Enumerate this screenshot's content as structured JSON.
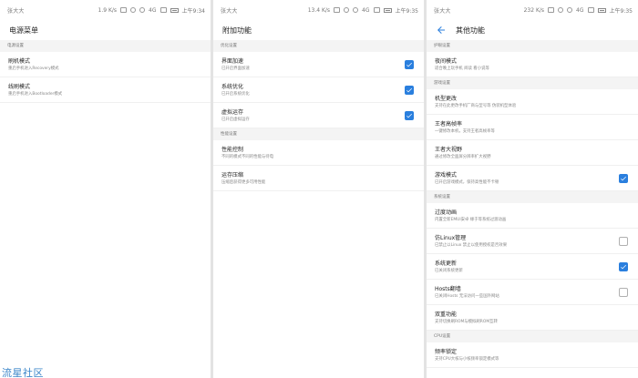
{
  "accent_color": "#2a7fde",
  "status_bars": [
    {
      "carrier": "张大大",
      "speed": "1.9 K/s",
      "network": "4G",
      "time": "上午9:34"
    },
    {
      "carrier": "张大大",
      "speed": "13.4 K/s",
      "network": "4G",
      "time": "上午9:35"
    },
    {
      "carrier": "张大大",
      "speed": "232 K/s",
      "network": "4G",
      "time": "上午9:35"
    }
  ],
  "power_menu": {
    "title": "电源菜单",
    "sections": [
      {
        "header": "电源设置",
        "items": [
          {
            "title": "刷机模式",
            "subtitle": "重启手机进入Recovery模式"
          },
          {
            "title": "线刷模式",
            "subtitle": "重启手机进入Bootloader模式"
          }
        ]
      }
    ]
  },
  "extra_functions": {
    "title": "附加功能",
    "sections": [
      {
        "header": "优化设置",
        "items": [
          {
            "title": "界面加速",
            "subtitle": "已开启界面加速",
            "checked": true
          },
          {
            "title": "系统优化",
            "subtitle": "已开启系统优化",
            "checked": true
          },
          {
            "title": "虚拟运存",
            "subtitle": "已开启虚拟运存",
            "checked": true
          }
        ]
      },
      {
        "header": "性能设置",
        "items": [
          {
            "title": "性能控制",
            "subtitle": "不同的模式不同的性能与待电"
          },
          {
            "title": "运存压缩",
            "subtitle": "压缩后获得更多可用性能"
          }
        ]
      }
    ]
  },
  "other_functions": {
    "title": "其他功能",
    "back_icon": "arrow-left-icon",
    "sections": [
      {
        "header": "护眼设置",
        "items": [
          {
            "title": "夜间模式",
            "subtitle": "适合晚上玩手机 阅读 看小说等"
          }
        ]
      },
      {
        "header": "游戏设置",
        "items": [
          {
            "title": "机型更改",
            "subtitle": "支持在此更改手机厂商与型号等 伪装机型体验"
          },
          {
            "title": "王者高帧率",
            "subtitle": "一键修改本机，支持王者高帧率等"
          },
          {
            "title": "王者大视野",
            "subtitle": "通过修改全面屏分辨率扩大视野"
          },
          {
            "title": "游戏模式",
            "subtitle": "已开启游戏模式，保持高性能不卡顿",
            "checked": true
          }
        ]
      },
      {
        "header": "系统设置",
        "items": [
          {
            "title": "过度动画",
            "subtitle": "内置全新EMUI安卓 缘于等系统过渡动画"
          },
          {
            "title": "仿Linux管理",
            "subtitle": "已禁止以Linux 禁止以使用授权是否效果",
            "checked": false
          },
          {
            "title": "系统更新",
            "subtitle": "已关闭系统更新",
            "checked": true
          },
          {
            "title": "Hosts翻墙",
            "subtitle": "已关闭Hosts 无法访问一些国外网站",
            "checked": false
          },
          {
            "title": "双重功能",
            "subtitle": "支持切换刷ROM与模拟刷ROM互转"
          }
        ]
      },
      {
        "header": "CPU设置",
        "items": [
          {
            "title": "频率锁定",
            "subtitle": "支持CPU大核与小核频率锁定模式等"
          }
        ]
      }
    ]
  },
  "watermark": "流星社区"
}
